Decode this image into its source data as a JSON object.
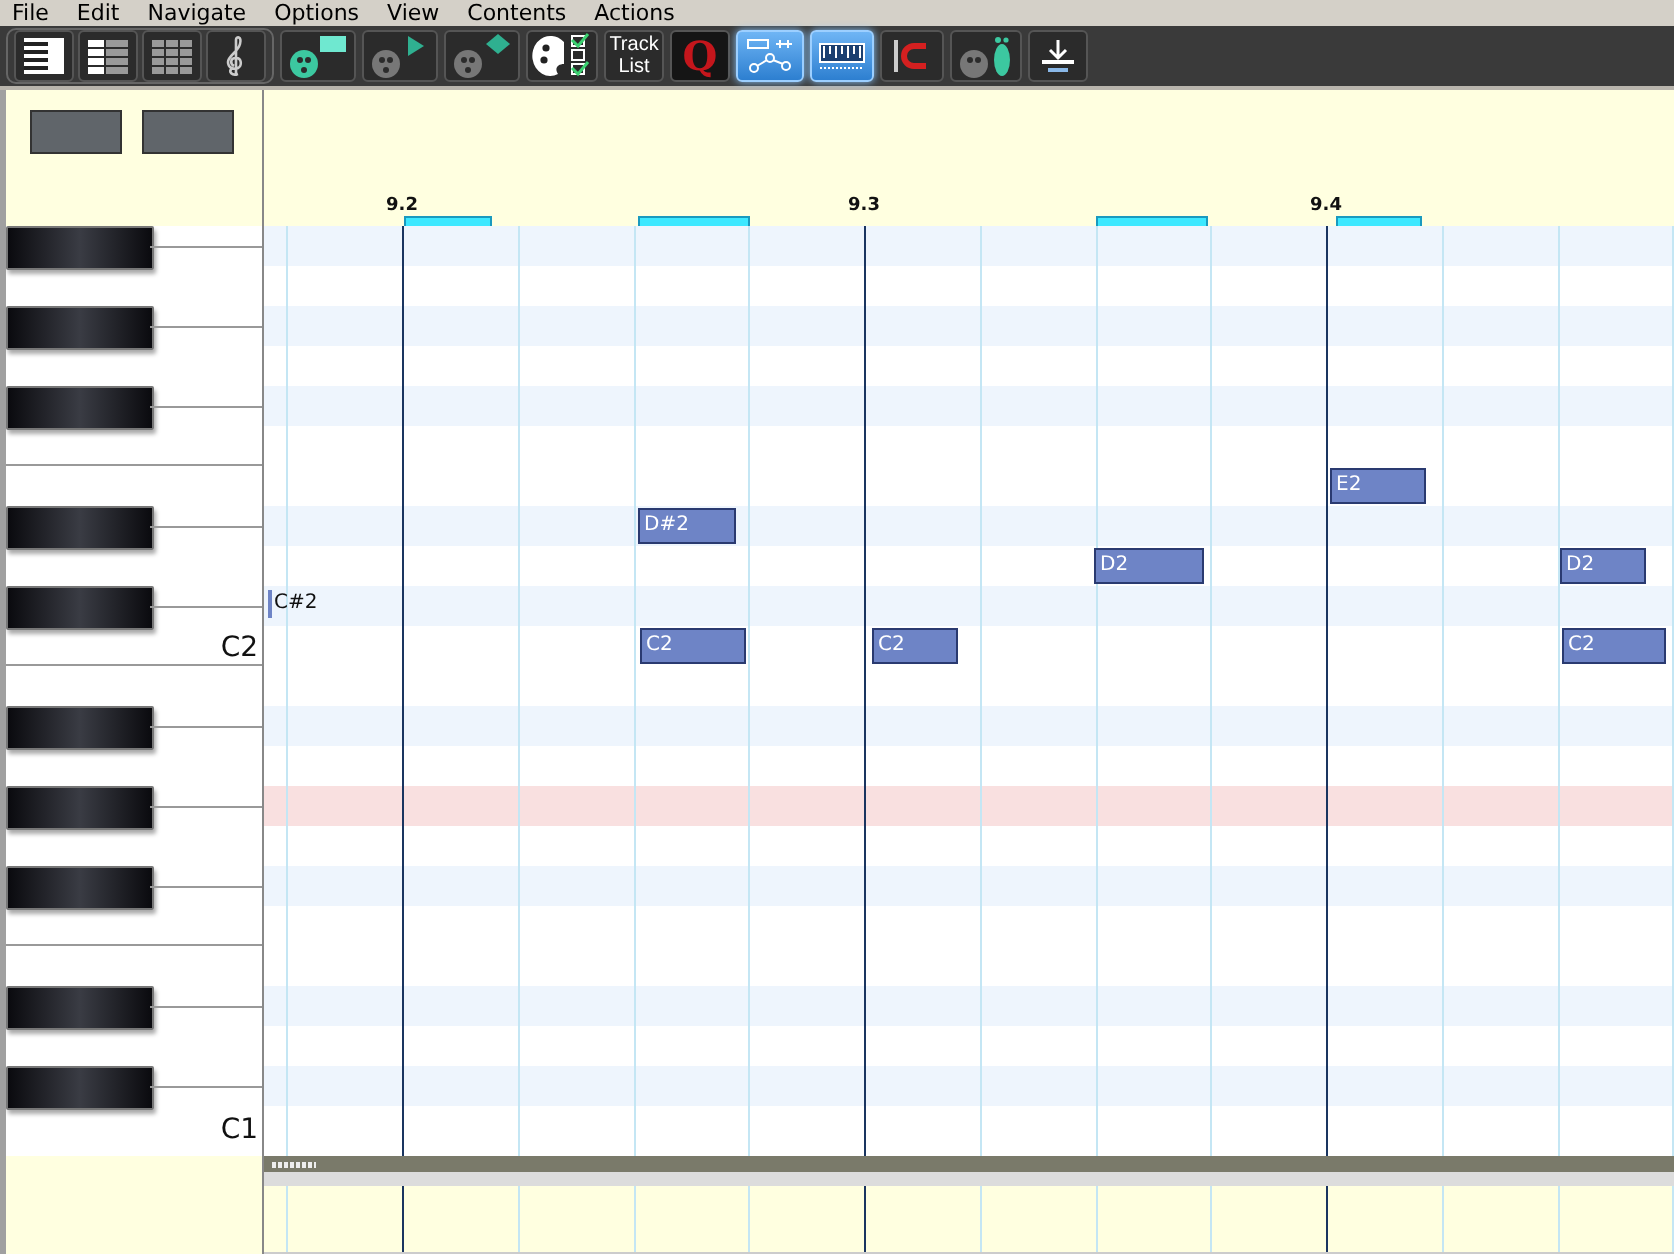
{
  "menu": [
    "File",
    "Edit",
    "Navigate",
    "Options",
    "View",
    "Contents",
    "Actions"
  ],
  "view_modes": [
    {
      "kind": "piano",
      "selected": false
    },
    {
      "kind": "list",
      "selected": false
    },
    {
      "kind": "grid",
      "selected": false
    },
    {
      "kind": "clef",
      "selected": false
    }
  ],
  "toolbar": [
    {
      "kind": "palette-rect",
      "selected": false
    },
    {
      "kind": "palette-play",
      "selected": false
    },
    {
      "kind": "palette-diamond",
      "selected": false
    },
    {
      "kind": "palette-check",
      "selected": false
    },
    {
      "kind": "text",
      "label": "Track List",
      "selected": false
    },
    {
      "kind": "quantize",
      "label": "Q",
      "selected": false
    },
    {
      "kind": "curve",
      "selected": true
    },
    {
      "kind": "ruler",
      "selected": true
    },
    {
      "kind": "magnet",
      "selected": false
    },
    {
      "kind": "foot",
      "selected": false
    },
    {
      "kind": "download",
      "selected": false
    }
  ],
  "ruler": {
    "labels": [
      "9.2",
      "9.3",
      "9.4"
    ]
  },
  "rows": [
    {
      "kind": "sharp",
      "highlighted": false,
      "notes": []
    },
    {
      "kind": "natural",
      "highlighted": false,
      "notes": []
    },
    {
      "kind": "sharp",
      "highlighted": false,
      "notes": []
    },
    {
      "kind": "natural",
      "highlighted": false,
      "notes": []
    },
    {
      "kind": "sharp",
      "highlighted": false,
      "notes": []
    },
    {
      "kind": "natural",
      "highlighted": false,
      "notes": []
    },
    {
      "kind": "natural",
      "highlighted": false,
      "notes": [
        {
          "label": "E2"
        }
      ]
    },
    {
      "kind": "sharp",
      "highlighted": false,
      "notes": [
        {
          "label": "D#2"
        }
      ]
    },
    {
      "kind": "natural",
      "highlighted": false,
      "notes": [
        {
          "label": "D2"
        },
        {
          "label": "D2"
        }
      ]
    },
    {
      "kind": "sharp",
      "highlighted": false,
      "hover_label": "C#2",
      "notes": []
    },
    {
      "kind": "natural",
      "highlighted": false,
      "key_label": "C2",
      "notes": [
        {
          "label": "C2"
        },
        {
          "label": "C2"
        },
        {
          "label": "C2"
        }
      ]
    },
    {
      "kind": "natural",
      "highlighted": false,
      "notes": []
    },
    {
      "kind": "sharp",
      "highlighted": false,
      "notes": []
    },
    {
      "kind": "natural",
      "highlighted": false,
      "notes": []
    },
    {
      "kind": "sharp",
      "highlighted": true,
      "notes": []
    },
    {
      "kind": "natural",
      "highlighted": false,
      "notes": []
    },
    {
      "kind": "sharp",
      "highlighted": false,
      "notes": []
    },
    {
      "kind": "natural",
      "highlighted": false,
      "notes": []
    },
    {
      "kind": "natural",
      "highlighted": false,
      "notes": []
    },
    {
      "kind": "sharp",
      "highlighted": false,
      "notes": []
    },
    {
      "kind": "natural",
      "highlighted": false,
      "notes": []
    },
    {
      "kind": "sharp",
      "highlighted": false,
      "notes": []
    },
    {
      "kind": "natural",
      "highlighted": false,
      "key_label": "C1",
      "notes": []
    }
  ]
}
